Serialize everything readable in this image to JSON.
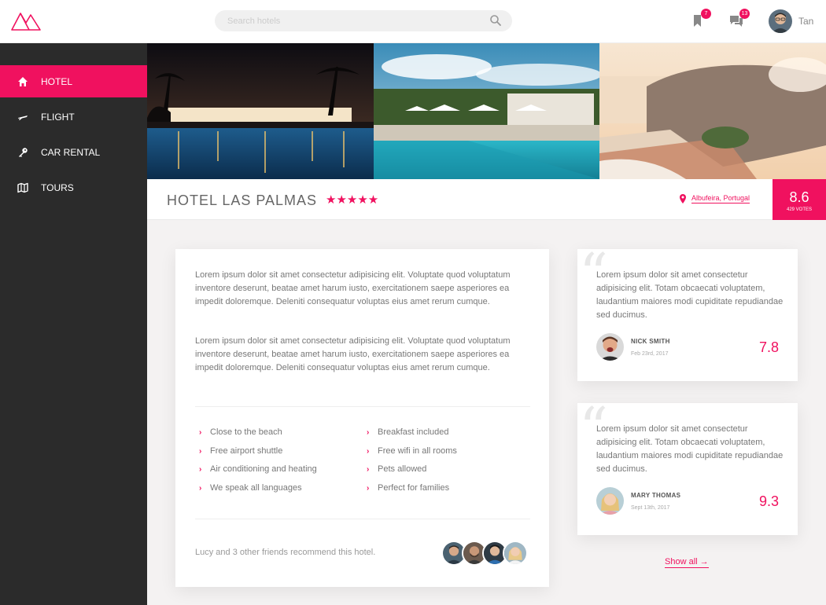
{
  "header": {
    "search_placeholder": "Search hotels",
    "bookmarks_badge": "7",
    "messages_badge": "13",
    "user_name": "Tan"
  },
  "sidebar": {
    "items": [
      {
        "label": "HOTEL",
        "icon": "home-icon",
        "active": true
      },
      {
        "label": "FLIGHT",
        "icon": "plane-icon",
        "active": false
      },
      {
        "label": "CAR RENTAL",
        "icon": "key-icon",
        "active": false
      },
      {
        "label": "TOURS",
        "icon": "map-icon",
        "active": false
      }
    ]
  },
  "hotel": {
    "name": "HOTEL LAS PALMAS",
    "stars": "★★★★★",
    "location": "Albufeira, Portugal",
    "score": "8.6",
    "votes": "429 VOTES"
  },
  "description": {
    "paragraphs": [
      "Lorem ipsum dolor sit amet consectetur adipisicing elit. Voluptate quod voluptatum inventore deserunt, beatae amet harum iusto, exercitationem saepe asperiores ea impedit doloremque. Deleniti consequatur voluptas eius amet rerum cumque.",
      "Lorem ipsum dolor sit amet consectetur adipisicing elit. Voluptate quod voluptatum inventore deserunt, beatae amet harum iusto, exercitationem saepe asperiores ea impedit doloremque. Deleniti consequatur voluptas eius amet rerum cumque."
    ],
    "amenities_left": [
      "Close to the beach",
      "Free airport shuttle",
      "Air conditioning and heating",
      "We speak all languages"
    ],
    "amenities_right": [
      "Breakfast included",
      "Free wifi in all rooms",
      "Pets allowed",
      "Perfect for families"
    ],
    "recommend_text": "Lucy and 3 other friends recommend this hotel."
  },
  "reviews": [
    {
      "text": "Lorem ipsum dolor sit amet consectetur adipisicing elit. Totam obcaecati voluptatem, laudantium maiores modi cupiditate repudiandae sed ducimus.",
      "name": "NICK SMITH",
      "date": "Feb 23rd, 2017",
      "score": "7.8"
    },
    {
      "text": "Lorem ipsum dolor sit amet consectetur adipisicing elit. Totam obcaecati voluptatem, laudantium maiores modi cupiditate repudiandae sed ducimus.",
      "name": "MARY THOMAS",
      "date": "Sept 13th, 2017",
      "score": "9.3"
    }
  ],
  "show_all_label": "Show all →",
  "colors": {
    "accent": "#f0115f",
    "sidebar": "#2b2b2b"
  }
}
